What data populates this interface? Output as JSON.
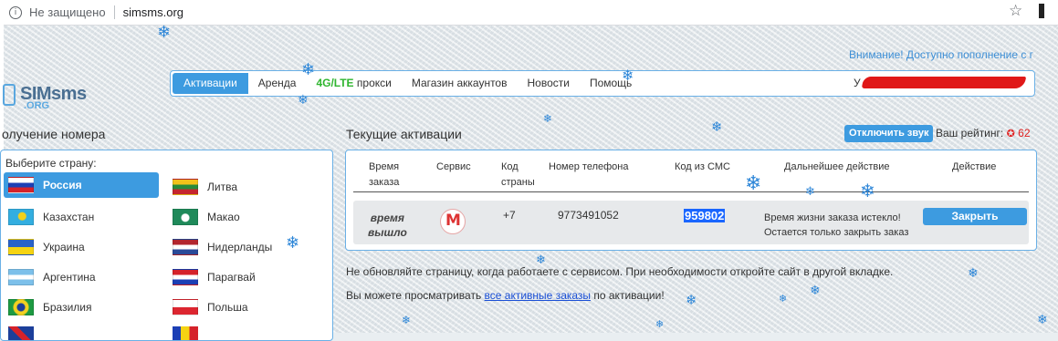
{
  "browser": {
    "security_label": "Не защищено",
    "url": "simsms.org",
    "info_icon": "info-icon",
    "star_icon": "star-icon"
  },
  "banner": {
    "notice": "Внимание! Доступно пополнение с г"
  },
  "logo": {
    "sims": "SIMsms",
    "org": ".ORG"
  },
  "nav": {
    "items": [
      {
        "label": "Активации",
        "active": true
      },
      {
        "label": "Аренда"
      },
      {
        "prefix": "4G/LTE",
        "label": " прокси"
      },
      {
        "label": "Магазин аккаунтов"
      },
      {
        "label": "Новости"
      },
      {
        "label": "Помощь"
      }
    ],
    "user_initial": "У"
  },
  "left": {
    "heading": "олучение номера",
    "choose_label": "Выберите страну:",
    "countries": [
      {
        "name": "Россия",
        "selected": true
      },
      {
        "name": "Литва"
      },
      {
        "name": "Казахстан"
      },
      {
        "name": "Макао"
      },
      {
        "name": "Украина"
      },
      {
        "name": "Нидерланды"
      },
      {
        "name": "Аргентина"
      },
      {
        "name": "Парагвай"
      },
      {
        "name": "Бразилия"
      },
      {
        "name": "Польша"
      }
    ]
  },
  "right": {
    "heading": "Текущие активации",
    "sound_button": "Отключить звук",
    "rating_label": "Ваш рейтинг:",
    "rating_value": "62",
    "table": {
      "headers": {
        "time_1": "Время",
        "time_2": "заказа",
        "service": "Сервис",
        "code_1": "Код",
        "code_2": "страны",
        "phone": "Номер телефона",
        "sms": "Код из СМС",
        "next": "Дальнейшее действие",
        "action": "Действие"
      },
      "row": {
        "status_1": "время",
        "status_2": "вышло",
        "service_letter": "M",
        "country_code": "+7",
        "phone": "9773491052",
        "sms_code": "959802",
        "next_1": "Время жизни заказа истекло!",
        "next_2": "Остается только закрыть заказ",
        "action_label": "Закрыть"
      }
    },
    "info_line_1": "Не обновляйте страницу, когда работаете с сервисом. При необходимости откройте сайт в другой вкладке.",
    "info_line_2_pre": "Вы можете просматривать ",
    "info_line_2_link": "все активные заказы",
    "info_line_2_post": " по активации!"
  },
  "colors": {
    "accent": "#3d9be0",
    "panel_border": "#6ab0e6",
    "green": "#2fb52f",
    "red": "#e02020"
  }
}
